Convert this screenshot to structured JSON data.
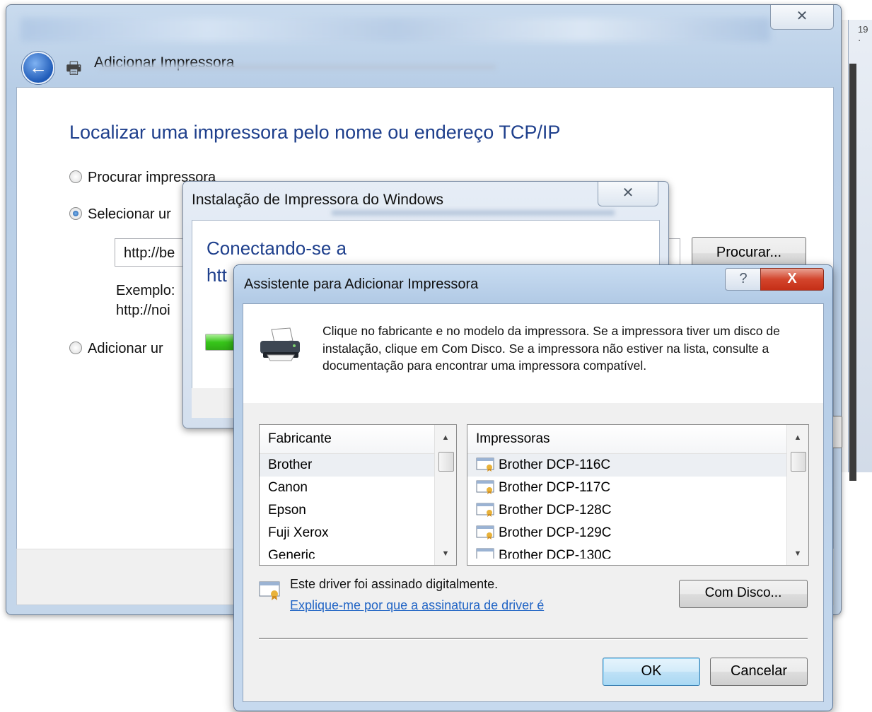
{
  "background": {
    "ruler_number": "19 ·"
  },
  "main_window": {
    "close_glyph": "✕",
    "back_glyph": "←",
    "title": "Adicionar Impressora",
    "heading": "Localizar uma impressora pelo nome ou endereço TCP/IP",
    "option_browse": "Procurar impressora",
    "option_select": "Selecionar ur",
    "url_value": "http://be",
    "example_label": "Exemplo:",
    "example_url": "http://noi",
    "option_add": "Adicionar ur",
    "browse_button": "Procurar..."
  },
  "install_dialog": {
    "title": "Instalação de Impressora do Windows",
    "close_glyph": "✕",
    "status": "Conectando-se a",
    "url_prefix": "htt",
    "progress_percent": 10
  },
  "assistant": {
    "title": "Assistente para Adicionar Impressora",
    "help_glyph": "?",
    "close_glyph": "X",
    "instructions": "Clique no fabricante e no modelo da impressora. Se a impressora tiver um disco de instalação, clique em Com Disco. Se a impressora não estiver na lista, consulte a documentação para encontrar uma impressora compatível.",
    "manufacturer_header": "Fabricante",
    "manufacturers": [
      "Brother",
      "Canon",
      "Epson",
      "Fuji Xerox",
      "Generic"
    ],
    "printers_header": "Impressoras",
    "printers": [
      "Brother DCP-116C",
      "Brother DCP-117C",
      "Brother DCP-128C",
      "Brother DCP-129C",
      "Brother DCP-130C"
    ],
    "signed_text": "Este driver foi assinado digitalmente.",
    "signed_link": "Explique-me por que a assinatura de driver é",
    "have_disk_button": "Com Disco...",
    "ok_button": "OK",
    "cancel_button": "Cancelar"
  },
  "colors": {
    "heading_blue": "#1e3f8c",
    "link_blue": "#2265c5",
    "close_red": "#c52f17"
  }
}
